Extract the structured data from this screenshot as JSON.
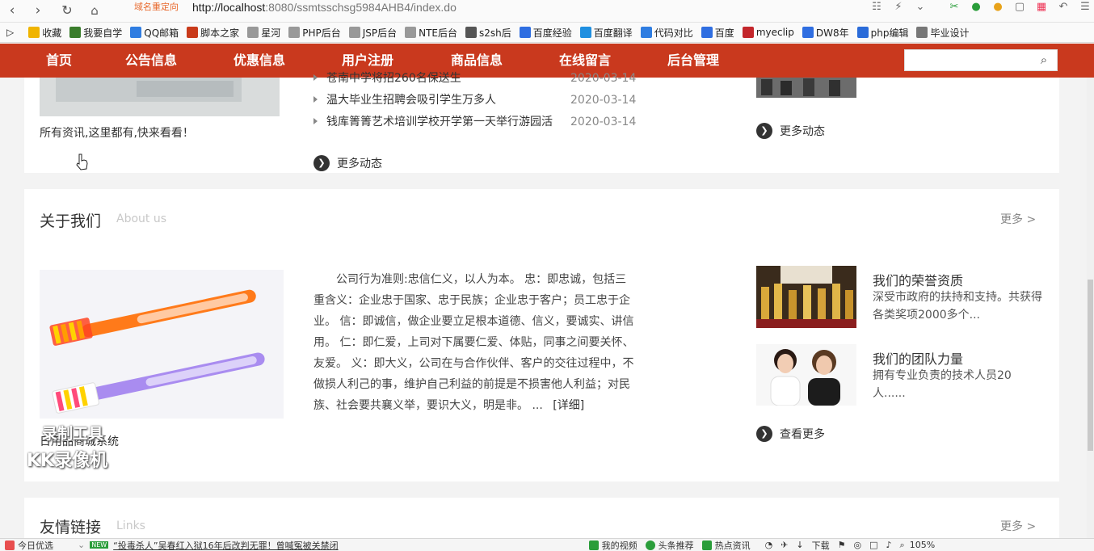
{
  "browser": {
    "redirect_label": "域名重定向",
    "url_host": "http://localhost",
    "url_rest": ":8080/ssmtsschsg5984AHB4/index.do",
    "bookmarks": [
      {
        "label": "收藏",
        "icon": "star-icon"
      },
      {
        "label": "我要自学",
        "icon": "book-icon"
      },
      {
        "label": "QQ邮箱",
        "icon": "qq-icon"
      },
      {
        "label": "脚本之家",
        "icon": "script-icon"
      },
      {
        "label": "星河",
        "icon": "page-icon"
      },
      {
        "label": "PHP后台",
        "icon": "page-icon"
      },
      {
        "label": "JSP后台",
        "icon": "page-icon"
      },
      {
        "label": "NTE后台",
        "icon": "page-icon"
      },
      {
        "label": "s2sh后",
        "icon": "image-icon"
      },
      {
        "label": "百度经验",
        "icon": "paw-icon"
      },
      {
        "label": "百度翻译",
        "icon": "translate-icon"
      },
      {
        "label": "代码对比",
        "icon": "compare-icon"
      },
      {
        "label": "百度",
        "icon": "paw-icon"
      },
      {
        "label": "myeclip",
        "icon": "eclipse-icon"
      },
      {
        "label": "DW8年",
        "icon": "paw-icon"
      },
      {
        "label": "php编辑",
        "icon": "k-icon"
      },
      {
        "label": "毕业设计",
        "icon": "avatar-icon"
      }
    ]
  },
  "nav": {
    "items": [
      "首页",
      "公告信息",
      "优惠信息",
      "用户注册",
      "商品信息",
      "在线留言",
      "后台管理"
    ],
    "search_placeholder": ""
  },
  "top_card": {
    "caption": "所有资讯,这里都有,快来看看！",
    "news": [
      {
        "title": "苍南中学将招260名保送生",
        "date": "2020-03-14"
      },
      {
        "title": "温大毕业生招聘会吸引学生万多人",
        "date": "2020-03-14"
      },
      {
        "title": "钱库箐箐艺术培训学校开学第一天举行游园活",
        "date": "2020-03-14"
      }
    ],
    "more_news": "更多动态",
    "more_right": "更多动态"
  },
  "about": {
    "title": "关于我们",
    "subtitle": "About us",
    "more": "更多 >",
    "caption": "日用品商城系统",
    "text": "公司行为准则:忠信仁义，以人为本。 忠：即忠诚，包括三重含义：企业忠于国家、忠于民族；企业忠于客户；员工忠于企业。 信：即诚信，做企业要立足根本道德、信义，要诚实、讲信用。 仁：即仁爱，上司对下属要仁爱、体贴，同事之间要关怀、友爱。 义：即大义，公司在与合作伙伴、客户的交往过程中，不做损人利己的事，维护自己利益的前提是不损害他人利益；对民族、社会要共襄义举，要识大义，明是非。 ...",
    "detail": "[详细]",
    "honors": [
      {
        "title": "我们的荣誉资质",
        "desc": "深受市政府的扶持和支持。共获得各类奖项2000多个..."
      },
      {
        "title": "我们的团队力量",
        "desc": "拥有专业负责的技术人员20人......"
      }
    ],
    "view_more": "查看更多"
  },
  "links": {
    "title": "友情链接",
    "subtitle": "Links",
    "more": "更多 >"
  },
  "watermark": {
    "line1": "录制工具",
    "line2": "KK录像机"
  },
  "taskbar": {
    "today": "今日优选",
    "badge": "NEW",
    "headline": "“投毒杀人”吴春红入狱16年后改判无罪！曾喊冤被关禁闭",
    "my_video": "我的视频",
    "headline_rec": "头条推荐",
    "hot_news": "热点资讯",
    "download": "下载",
    "zoom": "105%"
  }
}
